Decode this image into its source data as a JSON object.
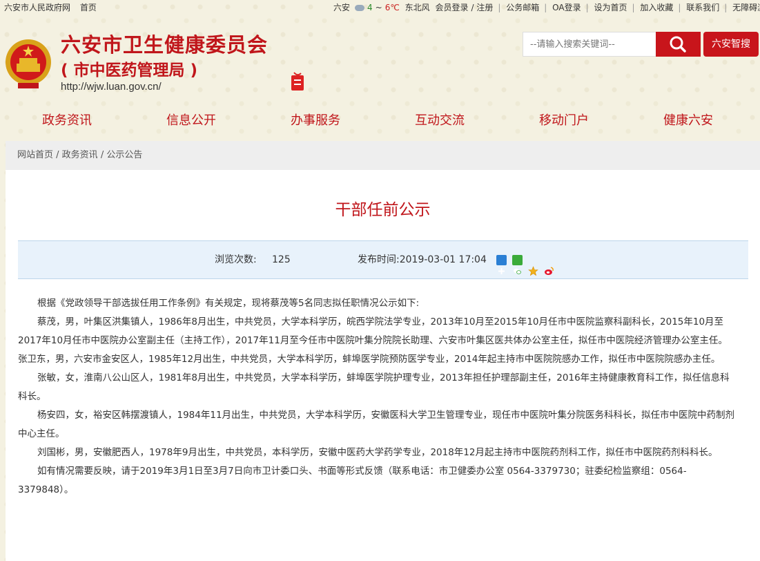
{
  "topbar": {
    "gov_link": "六安市人民政府网",
    "home": "首页",
    "city": "六安",
    "temp_low": "4",
    "temp_sep": "~",
    "temp_high": "6℃",
    "wind": "东北风",
    "login": "会员登录",
    "register": "注册",
    "mail": "公务邮箱",
    "oa": "OA登录",
    "set_home": "设为首页",
    "favorite": "加入收藏",
    "contact": "联系我们",
    "accessible": "无障碍浏览"
  },
  "header": {
    "title": "六安市卫生健康委员会",
    "subtitle": "( 市中医药管理局 )",
    "url": "http://wjw.luan.gov.cn/"
  },
  "search": {
    "placeholder": "--请输入搜索关键词--",
    "liuan_label": "六安智搜"
  },
  "nav": {
    "items": [
      "政务资讯",
      "信息公开",
      "办事服务",
      "互动交流",
      "移动门户",
      "健康六安"
    ]
  },
  "breadcrumb": {
    "home": "网站首页",
    "section": "政务资讯",
    "current": "公示公告",
    "sep": " / "
  },
  "article": {
    "title": "干部任前公示",
    "views_label": "浏览次数:",
    "views": "125",
    "published_label": "发布时间:",
    "published": "2019-03-01 17:04",
    "paragraphs": [
      "根据《党政领导干部选拔任用工作条例》有关规定，现将蔡茂等5名同志拟任职情况公示如下:",
      "蔡茂，男，叶集区洪集镇人，1986年8月出生，中共党员，大学本科学历，皖西学院法学专业，2013年10月至2015年10月任市中医院监察科副科长，2015年10月至2017年10月任市中医院办公室副主任（主持工作），2017年11月至今任市中医院叶集分院院长助理、六安市叶集区医共体办公室主任，拟任市中医院经济管理办公室主任。",
      "张卫东，男，六安市金安区人，1985年12月出生，中共党员，大学本科学历，蚌埠医学院预防医学专业，2014年起主持市中医院院感办工作，拟任市中医院院感办主任。",
      "张敏，女，淮南八公山区人，1981年8月出生，中共党员，大学本科学历，蚌埠医学院护理专业，2013年担任护理部副主任，2016年主持健康教育科工作，拟任信息科科长。",
      "杨安四，女，裕安区韩摆渡镇人，1984年11月出生，中共党员，大学本科学历，安徽医科大学卫生管理专业，现任市中医院叶集分院医务科科长，拟任市中医院中药制剂中心主任。",
      "刘国彬，男，安徽肥西人，1978年9月出生，中共党员，本科学历，安徽中医药大学药学专业，2018年12月起主持市中医院药剂科工作，拟任市中医院药剂科科长。",
      "如有情况需要反映，请于2019年3月1日至3月7日向市卫计委口头、书面等形式反馈（联系电话：市卫健委办公室 0564-3379730；驻委纪检监察组：0564-3379848）。"
    ]
  },
  "colors": {
    "brand_red": "#c0161b",
    "background": "#f4f1e1",
    "meta_bg": "#e8f2fb"
  },
  "icons": [
    "search-icon",
    "share-plus-icon",
    "wechat-icon",
    "qzone-star-icon",
    "weibo-icon",
    "emblem-icon",
    "seal-icon",
    "weather-cloud-icon"
  ]
}
